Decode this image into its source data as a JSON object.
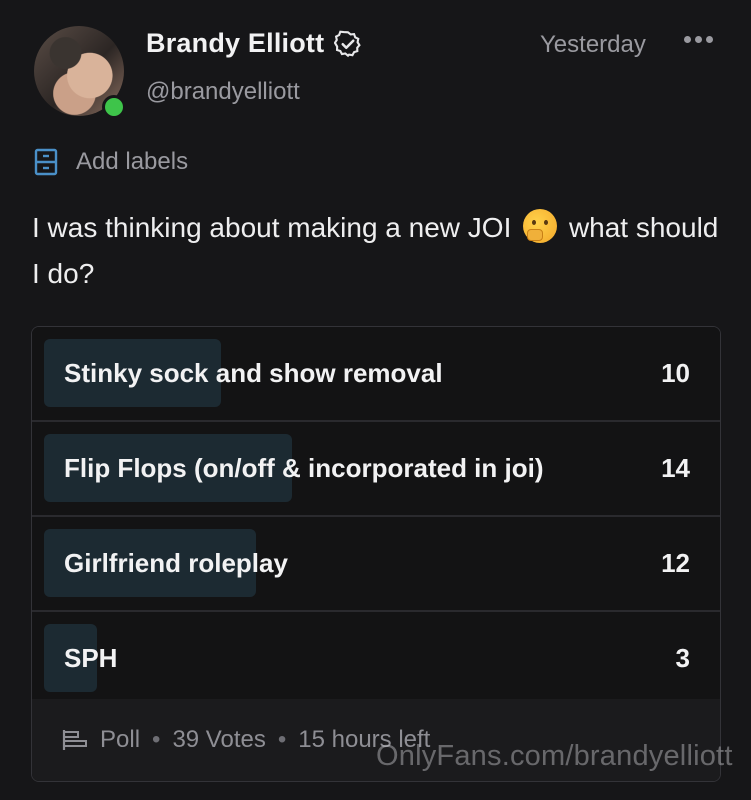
{
  "author": {
    "name": "Brandy Elliott",
    "handle": "@brandyelliott",
    "verified": true,
    "online": true
  },
  "post": {
    "time": "Yesterday",
    "labels_text": "Add labels",
    "text_before_emoji": "I was thinking about making a new JOI",
    "emoji": "thinking-face",
    "text_after_emoji": "what should I do?"
  },
  "poll": {
    "options": [
      {
        "label": "Stinky sock and show removal",
        "count": "10",
        "share": 0.2564
      },
      {
        "label": "Flip Flops (on/off & incorporated in joi)",
        "count": "14",
        "share": 0.359
      },
      {
        "label": "Girlfriend roleplay",
        "count": "12",
        "share": 0.3077
      },
      {
        "label": "SPH",
        "count": "3",
        "share": 0.0769
      }
    ],
    "footer": {
      "type": "Poll",
      "votes": "39 Votes",
      "time_left": "15 hours left"
    }
  },
  "watermark": "OnlyFans.com/brandyelliott",
  "colors": {
    "background": "#161618",
    "bar": "#1c2a32",
    "online": "#3ec44a",
    "label_icon": "#4a90c8"
  }
}
